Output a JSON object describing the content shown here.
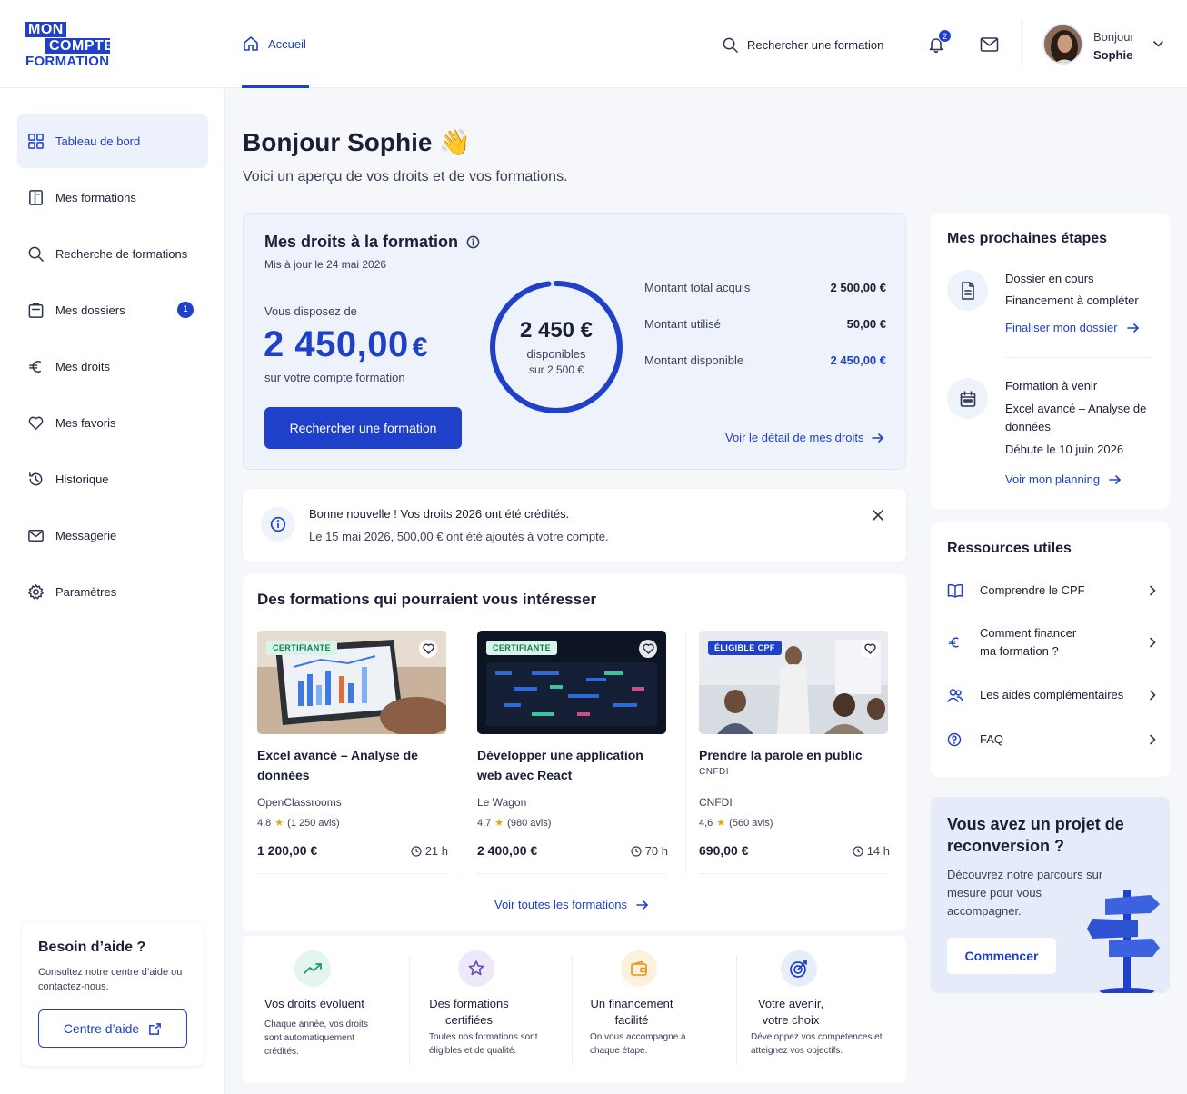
{
  "brand": {
    "line1": "MON",
    "line2": "COMPTE",
    "line3": "FORMATION"
  },
  "header": {
    "nav_home": "Accueil",
    "search_label": "Rechercher une formation",
    "notif_count": "2",
    "greeting": "Bonjour",
    "user_name": "Sophie"
  },
  "sidebar": {
    "items": [
      {
        "label": "Tableau de bord",
        "icon": "grid-icon",
        "active": true
      },
      {
        "label": "Mes formations",
        "icon": "book-icon"
      },
      {
        "label": "Recherche de formations",
        "icon": "search-icon"
      },
      {
        "label": "Mes dossiers",
        "icon": "folder-icon",
        "count": "1"
      },
      {
        "label": "Mes droits",
        "icon": "euro-icon"
      },
      {
        "label": "Mes favoris",
        "icon": "heart-icon"
      },
      {
        "label": "Historique",
        "icon": "history-icon"
      },
      {
        "label": "Messagerie",
        "icon": "mail-icon"
      },
      {
        "label": "Paramètres",
        "icon": "gear-icon"
      }
    ],
    "help": {
      "title": "Besoin d’aide ?",
      "text": "Consultez notre centre d’aide ou contactez-nous.",
      "button": "Centre d’aide"
    }
  },
  "main": {
    "title": "Bonjour Sophie 👋",
    "subtitle": "Voici un aperçu de vos droits et de vos formations.",
    "rights": {
      "title": "Mes droits à la formation",
      "updated": "Mis à jour le 24 mai 2026",
      "available_prefix": "Vous disposez de",
      "amount": "2 450,00",
      "currency": "€",
      "account_suffix": "sur votre compte formation",
      "cta": "Rechercher une formation",
      "ring_value": "2 450 €",
      "ring_label": "disponibles",
      "ring_total": "sur 2 500 €",
      "ring_fraction": 0.98,
      "breakdown": [
        {
          "label": "Montant total acquis",
          "value": "2 500,00 €"
        },
        {
          "label": "Montant utilisé",
          "value": "50,00 €"
        },
        {
          "label": "Montant disponible",
          "value": "2 450,00 €"
        }
      ],
      "detail_link": "Voir le détail de mes droits"
    },
    "notice": {
      "title": "Bonne nouvelle ! Vos droits 2026 ont été crédités.",
      "text": "Le 15 mai 2026, 500,00 € ont été ajoutés à votre compte."
    },
    "recommendations": {
      "title": "Des formations qui pourraient vous intéresser",
      "courses": [
        {
          "tag": "CERTIFIANTE",
          "name": "Excel avancé – Analyse de données",
          "org": "OpenClassrooms",
          "rating": "4,8",
          "reviews": "(1 250 avis)",
          "price": "1 200,00 €",
          "duration": "21 h"
        },
        {
          "tag": "CERTIFIANTE",
          "name": "Développer une application web avec React",
          "org": "Le Wagon",
          "rating": "4,7",
          "reviews": "(980 avis)",
          "price": "2 400,00 €",
          "duration": "70 h"
        },
        {
          "tag": "ÉLIGIBLE CPF",
          "name": "Prendre la parole en public",
          "subtitle": "CNFDI",
          "org": "CNFDI",
          "rating": "4,6",
          "reviews": "(560 avis)",
          "price": "690,00 €",
          "duration": "14 h"
        }
      ],
      "all_link": "Voir toutes les formations"
    },
    "features": [
      {
        "title": "Vos droits évoluent",
        "text": "Chaque année, vos droits sont automatiquement crédités.",
        "color": "#e3f5ec"
      },
      {
        "title": "Des formations certifiées",
        "text": "Toutes nos formations sont éligibles et de qualité.",
        "color": "#eee9fa"
      },
      {
        "title": "Un financement facilité",
        "text": "On vous accompagne à chaque étape.",
        "color": "#fdf1dc"
      },
      {
        "title": "Votre avenir, votre choix",
        "text": "Développez vos compétences et atteignez vos objectifs.",
        "color": "#e6edfb"
      }
    ]
  },
  "right": {
    "steps": {
      "title": "Mes prochaines étapes",
      "s1_title": "Dossier en cours",
      "s1_text": "Financement à compléter",
      "s1_link": "Finaliser mon dossier",
      "s2_title": "Formation à venir",
      "s2_text": "Excel avancé – Analyse de données",
      "s2_date": "Débute le 10 juin 2026",
      "s2_link": "Voir mon planning"
    },
    "resources": {
      "title": "Ressources utiles",
      "items": [
        {
          "label": "Comprendre le CPF",
          "icon": "book-open-icon"
        },
        {
          "label": "Comment financer ma formation ?",
          "icon": "euro-icon"
        },
        {
          "label": "Les aides complémentaires",
          "icon": "users-icon"
        },
        {
          "label": "FAQ",
          "icon": "question-icon"
        }
      ]
    },
    "promo": {
      "title": "Vous avez un projet de reconversion ?",
      "text": "Découvrez notre parcours sur mesure pour vous accompagner.",
      "button": "Commencer"
    }
  },
  "colors": {
    "primary": "#1f40c8",
    "soft_blue": "#eef2fb",
    "page_bg": "#f6f7fb"
  }
}
